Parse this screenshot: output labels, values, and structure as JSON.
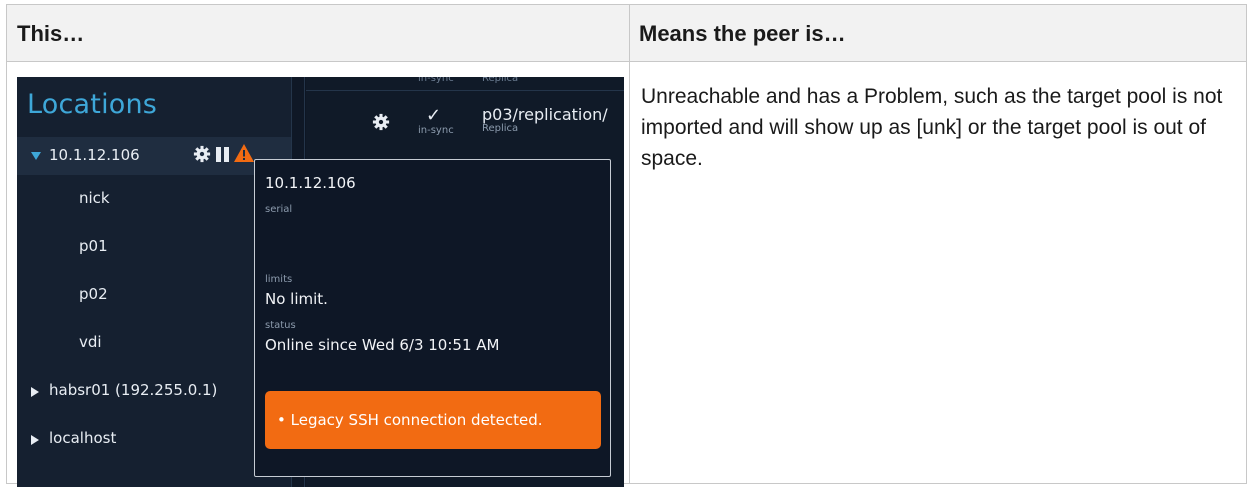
{
  "header": {
    "col1": "This…",
    "col2": "Means the peer is…"
  },
  "description": "Unreachable and has a Problem, such as the target pool is not imported and will show up as [unk] or the target pool is out of space.",
  "screenshot": {
    "sidebar": {
      "title": "Locations",
      "selected_node": "10.1.12.106",
      "pools": [
        "nick",
        "p01",
        "p02",
        "vdi"
      ],
      "other_hosts": [
        "habsr01 (192.255.0.1)",
        "localhost"
      ]
    },
    "replication": {
      "faint_status": "in-sync",
      "faint_type": "Replica",
      "status": "in-sync",
      "path": "p03/replication/",
      "type": "Replica"
    },
    "tooltip": {
      "title": "10.1.12.106",
      "serial_label": "serial",
      "limits_label": "limits",
      "limits_value": "No limit.",
      "status_label": "status",
      "status_value": "Online since Wed 6/3 10:51 AM",
      "alert": "• Legacy SSH connection detected."
    },
    "colors": {
      "accent": "#3ea7d8",
      "warning": "#f26b12",
      "background": "#0d1624"
    }
  }
}
